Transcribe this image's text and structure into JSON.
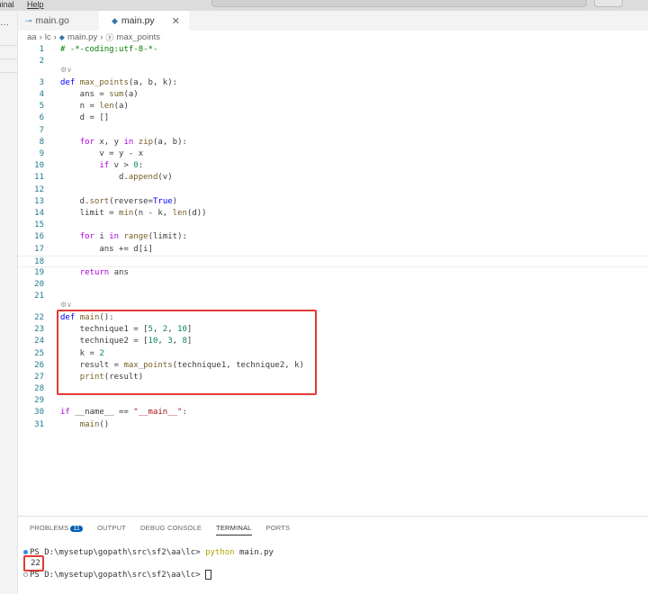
{
  "menubar": {
    "items": [
      "minal",
      "Help"
    ]
  },
  "tabs": [
    {
      "label": "main.go",
      "icon": "go-icon"
    },
    {
      "label": "main.py",
      "icon": "python-icon",
      "active": true
    }
  ],
  "breadcrumb": [
    "aa",
    "lc",
    "main.py",
    "max_points"
  ],
  "codelens_icon": "⚙∨",
  "code": [
    {
      "n": "1",
      "t": [
        [
          "# -*-coding:utf-8-*-",
          "cm"
        ]
      ]
    },
    {
      "n": "2",
      "t": []
    },
    {
      "lens": true
    },
    {
      "n": "3",
      "t": [
        [
          "def ",
          "df"
        ],
        [
          "max_points",
          "fn"
        ],
        [
          "(a, b, k):",
          ""
        ]
      ]
    },
    {
      "n": "4",
      "t": [
        [
          "    ans = ",
          ""
        ],
        [
          "sum",
          "fn"
        ],
        [
          "(a)",
          ""
        ]
      ]
    },
    {
      "n": "5",
      "t": [
        [
          "    n = ",
          ""
        ],
        [
          "len",
          "fn"
        ],
        [
          "(a)",
          ""
        ]
      ]
    },
    {
      "n": "6",
      "t": [
        [
          "    d = []",
          ""
        ]
      ]
    },
    {
      "n": "7",
      "t": []
    },
    {
      "n": "8",
      "t": [
        [
          "    ",
          ""
        ],
        [
          "for",
          "kw"
        ],
        [
          " x, y ",
          ""
        ],
        [
          "in",
          "kw"
        ],
        [
          " ",
          ""
        ],
        [
          "zip",
          "fn"
        ],
        [
          "(a, b):",
          ""
        ]
      ]
    },
    {
      "n": "9",
      "t": [
        [
          "        v = y - x",
          ""
        ]
      ]
    },
    {
      "n": "10",
      "t": [
        [
          "        ",
          ""
        ],
        [
          "if",
          "kw"
        ],
        [
          " v > ",
          ""
        ],
        [
          "0",
          "nm"
        ],
        [
          ":",
          ""
        ]
      ]
    },
    {
      "n": "11",
      "t": [
        [
          "            d.",
          ""
        ],
        [
          "append",
          "fn"
        ],
        [
          "(v)",
          ""
        ]
      ]
    },
    {
      "n": "12",
      "t": []
    },
    {
      "n": "13",
      "t": [
        [
          "    d.",
          ""
        ],
        [
          "sort",
          "fn"
        ],
        [
          "(reverse=",
          ""
        ],
        [
          "True",
          "bl"
        ],
        [
          ")",
          ""
        ]
      ]
    },
    {
      "n": "14",
      "t": [
        [
          "    limit = ",
          ""
        ],
        [
          "min",
          "fn"
        ],
        [
          "(n - k, ",
          ""
        ],
        [
          "len",
          "fn"
        ],
        [
          "(d))",
          ""
        ]
      ]
    },
    {
      "n": "15",
      "t": []
    },
    {
      "n": "16",
      "t": [
        [
          "    ",
          ""
        ],
        [
          "for",
          "kw"
        ],
        [
          " i ",
          ""
        ],
        [
          "in",
          "kw"
        ],
        [
          " ",
          ""
        ],
        [
          "range",
          "fn"
        ],
        [
          "(limit):",
          ""
        ]
      ]
    },
    {
      "n": "17",
      "t": [
        [
          "        ans += d[i]",
          ""
        ]
      ]
    },
    {
      "n": "18",
      "t": [],
      "cur": true
    },
    {
      "n": "19",
      "t": [
        [
          "    ",
          ""
        ],
        [
          "return",
          "kw"
        ],
        [
          " ans",
          ""
        ]
      ]
    },
    {
      "n": "20",
      "t": []
    },
    {
      "n": "21",
      "t": []
    },
    {
      "lens": true
    },
    {
      "n": "22",
      "t": [
        [
          "def ",
          "df"
        ],
        [
          "main",
          "fn"
        ],
        [
          "():",
          ""
        ]
      ]
    },
    {
      "n": "23",
      "t": [
        [
          "    technique1 = [",
          ""
        ],
        [
          "5",
          "nm"
        ],
        [
          ", ",
          ""
        ],
        [
          "2",
          "nm"
        ],
        [
          ", ",
          ""
        ],
        [
          "10",
          "nm"
        ],
        [
          "]",
          ""
        ]
      ]
    },
    {
      "n": "24",
      "t": [
        [
          "    technique2 = [",
          ""
        ],
        [
          "10",
          "nm"
        ],
        [
          ", ",
          ""
        ],
        [
          "3",
          "nm"
        ],
        [
          ", ",
          ""
        ],
        [
          "8",
          "nm"
        ],
        [
          "]",
          ""
        ]
      ]
    },
    {
      "n": "25",
      "t": [
        [
          "    k = ",
          ""
        ],
        [
          "2",
          "nm"
        ]
      ]
    },
    {
      "n": "26",
      "t": [
        [
          "    result = ",
          ""
        ],
        [
          "max_points",
          "fn"
        ],
        [
          "(technique1, technique2, k)",
          ""
        ]
      ]
    },
    {
      "n": "27",
      "t": [
        [
          "    ",
          ""
        ],
        [
          "print",
          "fn"
        ],
        [
          "(result)",
          ""
        ]
      ]
    },
    {
      "n": "28",
      "t": []
    },
    {
      "n": "29",
      "t": []
    },
    {
      "n": "30",
      "t": [
        [
          "if",
          "kw"
        ],
        [
          " __name__ == ",
          ""
        ],
        [
          "\"__main__\"",
          "st"
        ],
        [
          ":",
          ""
        ]
      ]
    },
    {
      "n": "31",
      "t": [
        [
          "    ",
          ""
        ],
        [
          "main",
          "fn"
        ],
        [
          "()",
          ""
        ]
      ]
    }
  ],
  "panel": {
    "tabs": [
      "PROBLEMS",
      "OUTPUT",
      "DEBUG CONSOLE",
      "TERMINAL",
      "PORTS"
    ],
    "problems_count": "11",
    "terminal": {
      "prompt1": "PS D:\\mysetup\\gopath\\src\\sf2\\aa\\lc> ",
      "cmd": "python",
      "arg": " main.py",
      "output": "22",
      "prompt2": "PS D:\\mysetup\\gopath\\src\\sf2\\aa\\lc> "
    }
  },
  "colors": {
    "highlight": "#e53935",
    "accent": "#005fb8"
  }
}
